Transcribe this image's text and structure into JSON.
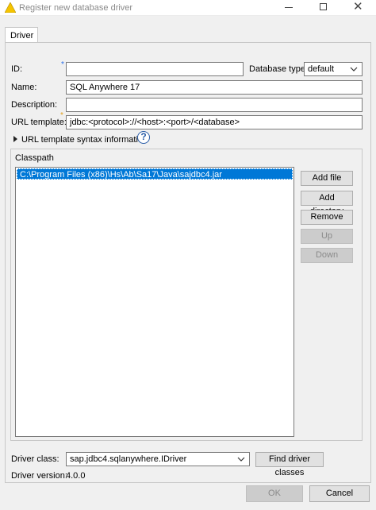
{
  "window": {
    "title": "Register new database driver"
  },
  "tabs": [
    {
      "label": "Driver"
    }
  ],
  "form": {
    "id_label": "ID:",
    "id_value": "",
    "required_mark": "*",
    "dbtype_label": "Database type:",
    "dbtype_value": "default",
    "name_label": "Name:",
    "name_value": "SQL Anywhere 17",
    "description_label": "Description:",
    "description_value": "",
    "url_label": "URL template:",
    "url_value": "jdbc:<protocol>://<host>:<port>/<database>",
    "url_info_label": "URL template syntax information"
  },
  "classpath": {
    "label": "Classpath",
    "items": [
      "C:\\Program Files (x86)\\Hs\\Ab\\Sa17\\Java\\sajdbc4.jar"
    ],
    "buttons": {
      "add_file": "Add file",
      "add_directory": "Add directory",
      "remove": "Remove",
      "up": "Up",
      "down": "Down"
    }
  },
  "driver": {
    "class_label": "Driver class:",
    "class_value": "sap.jdbc4.sqlanywhere.IDriver",
    "find_button": "Find driver classes",
    "version_label": "Driver version:",
    "version_value": "4.0.0"
  },
  "dialog_buttons": {
    "ok": "OK",
    "cancel": "Cancel"
  }
}
